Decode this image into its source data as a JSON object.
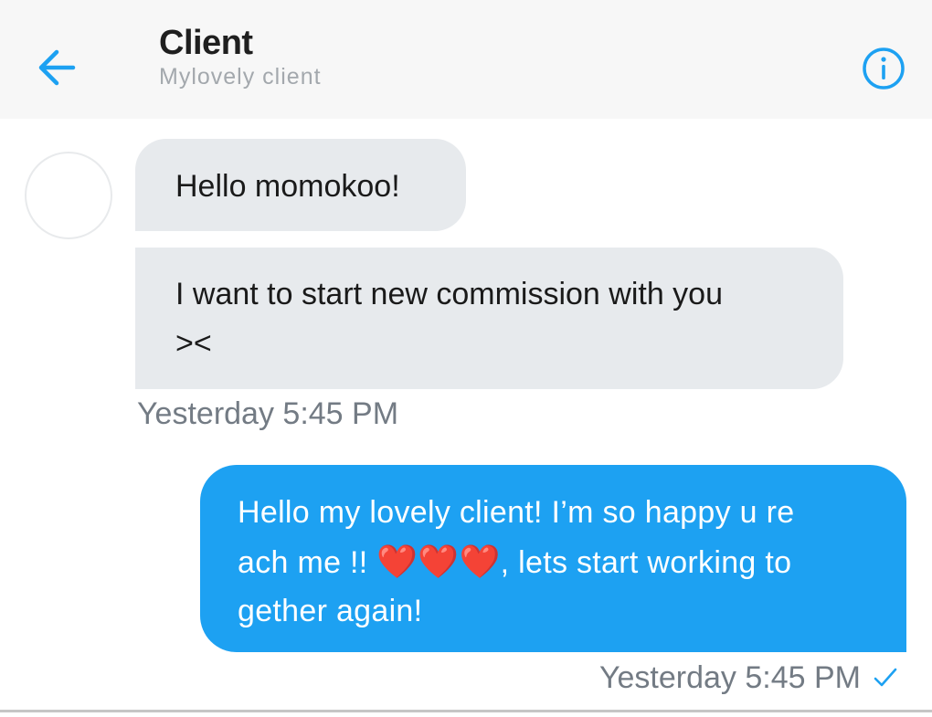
{
  "header": {
    "title": "Client",
    "subtitle": "Mylovely client",
    "back_icon": "arrow-left-icon",
    "info_icon": "info-circle-icon",
    "accent_color": "#1da1f2"
  },
  "messages": [
    {
      "direction": "incoming",
      "text": "Hello momokoo!"
    },
    {
      "direction": "incoming",
      "line1": "I want to start new commission with you",
      "line2": "><"
    }
  ],
  "incoming_timestamp": "Yesterday 5:45 PM",
  "outgoing": {
    "line1": "Hello my lovely client! I’m so happy u re",
    "line2_before": "ach me !! ",
    "hearts": "❤️❤️❤️",
    "line2_after": ", lets start working to",
    "line3": "gether again!",
    "bubble_color": "#1da1f2"
  },
  "outgoing_timestamp": "Yesterday 5:45 PM",
  "read_status_icon": "checkmark-icon"
}
